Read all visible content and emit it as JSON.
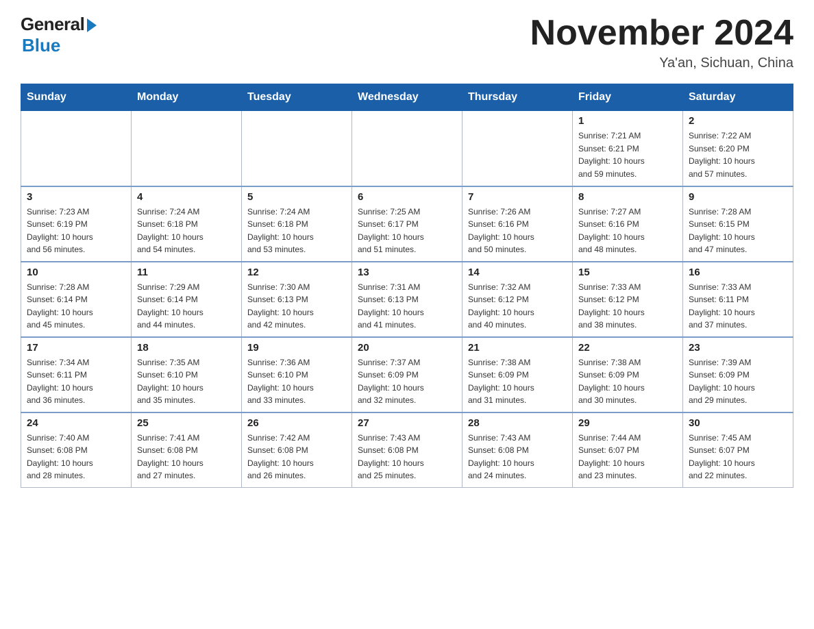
{
  "header": {
    "logo_general": "General",
    "logo_blue": "Blue",
    "title": "November 2024",
    "location": "Ya'an, Sichuan, China"
  },
  "days_of_week": [
    "Sunday",
    "Monday",
    "Tuesday",
    "Wednesday",
    "Thursday",
    "Friday",
    "Saturday"
  ],
  "weeks": [
    [
      {
        "day": "",
        "info": ""
      },
      {
        "day": "",
        "info": ""
      },
      {
        "day": "",
        "info": ""
      },
      {
        "day": "",
        "info": ""
      },
      {
        "day": "",
        "info": ""
      },
      {
        "day": "1",
        "info": "Sunrise: 7:21 AM\nSunset: 6:21 PM\nDaylight: 10 hours\nand 59 minutes."
      },
      {
        "day": "2",
        "info": "Sunrise: 7:22 AM\nSunset: 6:20 PM\nDaylight: 10 hours\nand 57 minutes."
      }
    ],
    [
      {
        "day": "3",
        "info": "Sunrise: 7:23 AM\nSunset: 6:19 PM\nDaylight: 10 hours\nand 56 minutes."
      },
      {
        "day": "4",
        "info": "Sunrise: 7:24 AM\nSunset: 6:18 PM\nDaylight: 10 hours\nand 54 minutes."
      },
      {
        "day": "5",
        "info": "Sunrise: 7:24 AM\nSunset: 6:18 PM\nDaylight: 10 hours\nand 53 minutes."
      },
      {
        "day": "6",
        "info": "Sunrise: 7:25 AM\nSunset: 6:17 PM\nDaylight: 10 hours\nand 51 minutes."
      },
      {
        "day": "7",
        "info": "Sunrise: 7:26 AM\nSunset: 6:16 PM\nDaylight: 10 hours\nand 50 minutes."
      },
      {
        "day": "8",
        "info": "Sunrise: 7:27 AM\nSunset: 6:16 PM\nDaylight: 10 hours\nand 48 minutes."
      },
      {
        "day": "9",
        "info": "Sunrise: 7:28 AM\nSunset: 6:15 PM\nDaylight: 10 hours\nand 47 minutes."
      }
    ],
    [
      {
        "day": "10",
        "info": "Sunrise: 7:28 AM\nSunset: 6:14 PM\nDaylight: 10 hours\nand 45 minutes."
      },
      {
        "day": "11",
        "info": "Sunrise: 7:29 AM\nSunset: 6:14 PM\nDaylight: 10 hours\nand 44 minutes."
      },
      {
        "day": "12",
        "info": "Sunrise: 7:30 AM\nSunset: 6:13 PM\nDaylight: 10 hours\nand 42 minutes."
      },
      {
        "day": "13",
        "info": "Sunrise: 7:31 AM\nSunset: 6:13 PM\nDaylight: 10 hours\nand 41 minutes."
      },
      {
        "day": "14",
        "info": "Sunrise: 7:32 AM\nSunset: 6:12 PM\nDaylight: 10 hours\nand 40 minutes."
      },
      {
        "day": "15",
        "info": "Sunrise: 7:33 AM\nSunset: 6:12 PM\nDaylight: 10 hours\nand 38 minutes."
      },
      {
        "day": "16",
        "info": "Sunrise: 7:33 AM\nSunset: 6:11 PM\nDaylight: 10 hours\nand 37 minutes."
      }
    ],
    [
      {
        "day": "17",
        "info": "Sunrise: 7:34 AM\nSunset: 6:11 PM\nDaylight: 10 hours\nand 36 minutes."
      },
      {
        "day": "18",
        "info": "Sunrise: 7:35 AM\nSunset: 6:10 PM\nDaylight: 10 hours\nand 35 minutes."
      },
      {
        "day": "19",
        "info": "Sunrise: 7:36 AM\nSunset: 6:10 PM\nDaylight: 10 hours\nand 33 minutes."
      },
      {
        "day": "20",
        "info": "Sunrise: 7:37 AM\nSunset: 6:09 PM\nDaylight: 10 hours\nand 32 minutes."
      },
      {
        "day": "21",
        "info": "Sunrise: 7:38 AM\nSunset: 6:09 PM\nDaylight: 10 hours\nand 31 minutes."
      },
      {
        "day": "22",
        "info": "Sunrise: 7:38 AM\nSunset: 6:09 PM\nDaylight: 10 hours\nand 30 minutes."
      },
      {
        "day": "23",
        "info": "Sunrise: 7:39 AM\nSunset: 6:09 PM\nDaylight: 10 hours\nand 29 minutes."
      }
    ],
    [
      {
        "day": "24",
        "info": "Sunrise: 7:40 AM\nSunset: 6:08 PM\nDaylight: 10 hours\nand 28 minutes."
      },
      {
        "day": "25",
        "info": "Sunrise: 7:41 AM\nSunset: 6:08 PM\nDaylight: 10 hours\nand 27 minutes."
      },
      {
        "day": "26",
        "info": "Sunrise: 7:42 AM\nSunset: 6:08 PM\nDaylight: 10 hours\nand 26 minutes."
      },
      {
        "day": "27",
        "info": "Sunrise: 7:43 AM\nSunset: 6:08 PM\nDaylight: 10 hours\nand 25 minutes."
      },
      {
        "day": "28",
        "info": "Sunrise: 7:43 AM\nSunset: 6:08 PM\nDaylight: 10 hours\nand 24 minutes."
      },
      {
        "day": "29",
        "info": "Sunrise: 7:44 AM\nSunset: 6:07 PM\nDaylight: 10 hours\nand 23 minutes."
      },
      {
        "day": "30",
        "info": "Sunrise: 7:45 AM\nSunset: 6:07 PM\nDaylight: 10 hours\nand 22 minutes."
      }
    ]
  ]
}
